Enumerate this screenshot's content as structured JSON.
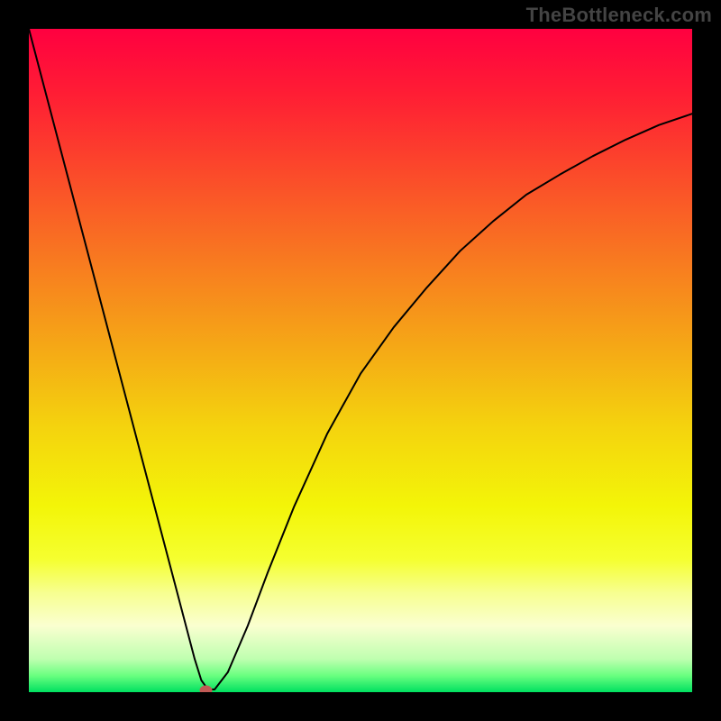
{
  "watermark": "TheBottleneck.com",
  "chart_data": {
    "type": "line",
    "title": "",
    "xlabel": "",
    "ylabel": "",
    "xlim": [
      0,
      100
    ],
    "ylim": [
      0,
      100
    ],
    "series": [
      {
        "name": "curve",
        "x": [
          0,
          5,
          10,
          15,
          20,
          22,
          24,
          25,
          26,
          27,
          28,
          30,
          33,
          36,
          40,
          45,
          50,
          55,
          60,
          65,
          70,
          75,
          80,
          85,
          90,
          95,
          100
        ],
        "values": [
          100,
          81,
          62,
          43,
          24,
          16.4,
          8.8,
          5,
          1.8,
          0.4,
          0.4,
          3,
          10,
          18,
          28,
          39,
          48,
          55,
          61,
          66.5,
          71,
          75,
          78,
          80.8,
          83.3,
          85.5,
          87.2
        ]
      }
    ],
    "marker": {
      "x": 26.7,
      "y": 0.3,
      "color": "#c15a55",
      "size": 7
    },
    "gradient_stops": [
      {
        "offset": 0.0,
        "color": "#ff0040"
      },
      {
        "offset": 0.1,
        "color": "#ff1e34"
      },
      {
        "offset": 0.22,
        "color": "#fb4b2a"
      },
      {
        "offset": 0.35,
        "color": "#f87a20"
      },
      {
        "offset": 0.48,
        "color": "#f5a816"
      },
      {
        "offset": 0.6,
        "color": "#f4d30e"
      },
      {
        "offset": 0.72,
        "color": "#f3f508"
      },
      {
        "offset": 0.8,
        "color": "#f5ff30"
      },
      {
        "offset": 0.85,
        "color": "#f7ff90"
      },
      {
        "offset": 0.9,
        "color": "#faffd0"
      },
      {
        "offset": 0.95,
        "color": "#bfffb0"
      },
      {
        "offset": 0.975,
        "color": "#6aff80"
      },
      {
        "offset": 1.0,
        "color": "#00e060"
      }
    ],
    "line_color": "#000000",
    "line_width": 2
  }
}
